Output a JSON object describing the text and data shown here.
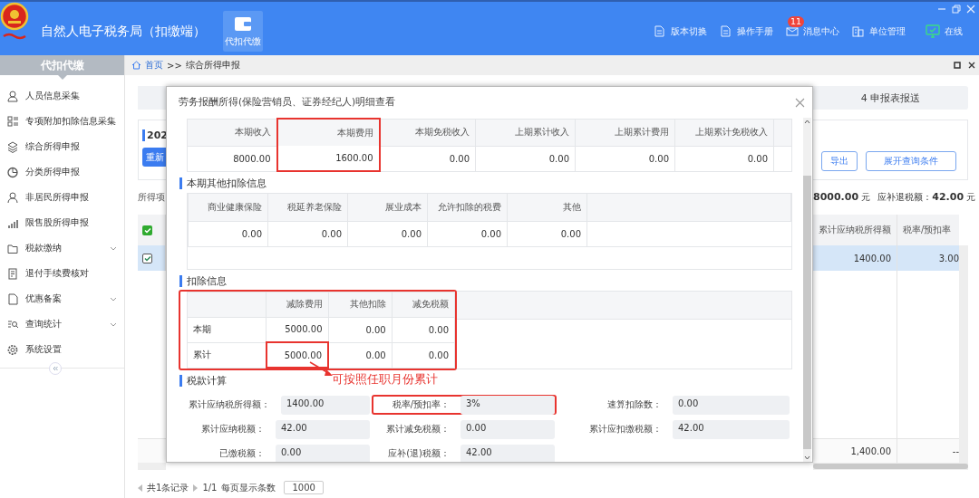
{
  "header": {
    "title": "自然人电子税务局（扣缴端）",
    "module": "代扣代缴",
    "nav": [
      {
        "label": "版本切换"
      },
      {
        "label": "操作手册"
      },
      {
        "label": "消息中心",
        "badge": "11"
      },
      {
        "label": "单位管理"
      },
      {
        "label": "在线",
        "kind": "status"
      }
    ]
  },
  "sidebar": {
    "title": "代扣代缴",
    "items": [
      {
        "label": "人员信息采集",
        "submenu": false
      },
      {
        "label": "专项附加扣除信息采集",
        "submenu": false
      },
      {
        "label": "综合所得申报",
        "submenu": false
      },
      {
        "label": "分类所得申报",
        "submenu": false
      },
      {
        "label": "非居民所得申报",
        "submenu": false
      },
      {
        "label": "限售股所得申报",
        "submenu": false
      },
      {
        "label": "税款缴纳",
        "submenu": true
      },
      {
        "label": "退付手续费核对",
        "submenu": false
      },
      {
        "label": "优惠备案",
        "submenu": true
      },
      {
        "label": "查询统计",
        "submenu": true
      },
      {
        "label": "系统设置",
        "submenu": false
      }
    ]
  },
  "breadcrumb": {
    "home": "首页",
    "separator": ">>",
    "current": "综合所得申报"
  },
  "background": {
    "step": "4 申报表报送",
    "card_title": "202",
    "reset_button": "重新",
    "buttons": [
      "导出",
      "展开查询条件"
    ],
    "summary_label": "所得项",
    "summary": [
      "**8000.00** 元",
      "应补退税额：**42.00** 元"
    ],
    "table": {
      "header_checked": true,
      "columns": [
        "累计应纳税所得额",
        "税率/预扣率"
      ],
      "rows": [
        {
          "selected": true,
          "checked": true,
          "cells": [
            "1400.00",
            "3.00"
          ]
        }
      ],
      "total": [
        "1,400.00",
        "--"
      ]
    },
    "pagination": {
      "records": "共1条记录",
      "pages": "1/1",
      "page_size_label": "每页显示条数",
      "page_size": "1000"
    }
  },
  "dialog": {
    "title": "劳务报酬所得(保险营销员、证券经纪人)明细查看",
    "income_table": {
      "columns": [
        {
          "label": "本期收入",
          "highlighted": false
        },
        {
          "label": "本期费用",
          "highlighted": true
        },
        {
          "label": "本期免税收入",
          "highlighted": false
        },
        {
          "label": "上期累计收入",
          "highlighted": false
        },
        {
          "label": "上期累计费用",
          "highlighted": false
        },
        {
          "label": "上期累计免税收入",
          "highlighted": false
        }
      ],
      "values": [
        "8000.00",
        "1600.00",
        "0.00",
        "0.00",
        "0.00",
        "0.00"
      ]
    },
    "other_deductions": {
      "title": "本期其他扣除信息",
      "columns": [
        "商业健康保险",
        "税延养老保险",
        "展业成本",
        "允许扣除的税费",
        "其他"
      ],
      "values": [
        "0.00",
        "0.00",
        "0.00",
        "0.00",
        "0.00"
      ]
    },
    "deductions": {
      "title": "扣除信息",
      "highlighted": true,
      "columns": [
        "减除费用",
        "其他扣除",
        "减免税额"
      ],
      "rows": [
        {
          "label": "本期",
          "cells": [
            {
              "value": "5000.00",
              "highlighted": false
            },
            {
              "value": "0.00",
              "highlighted": false
            },
            {
              "value": "0.00",
              "highlighted": false
            }
          ]
        },
        {
          "label": "累计",
          "cells": [
            {
              "value": "5000.00",
              "highlighted": true,
              "note": "可按照任职月份累计"
            },
            {
              "value": "0.00",
              "highlighted": false
            },
            {
              "value": "0.00",
              "highlighted": false
            }
          ]
        }
      ]
    },
    "tax_calc": {
      "title": "税款计算",
      "fields": [
        {
          "label": "累计应纳税所得额：",
          "value": "1400.00",
          "highlighted": false
        },
        {
          "label": "税率/预扣率：",
          "value": "3%",
          "highlighted": true
        },
        {
          "label": "速算扣除数：",
          "value": "0.00",
          "highlighted": false
        },
        {
          "label": "累计应纳税额：",
          "value": "42.00",
          "highlighted": false
        },
        {
          "label": "累计减免税额：",
          "value": "0.00",
          "highlighted": false
        },
        {
          "label": "累计应扣缴税额：",
          "value": "42.00",
          "highlighted": false
        },
        {
          "label": "已缴税额：",
          "value": "0.00",
          "highlighted": false
        },
        {
          "label": "应补(退)税额：",
          "value": "42.00",
          "highlighted": false
        }
      ]
    }
  }
}
